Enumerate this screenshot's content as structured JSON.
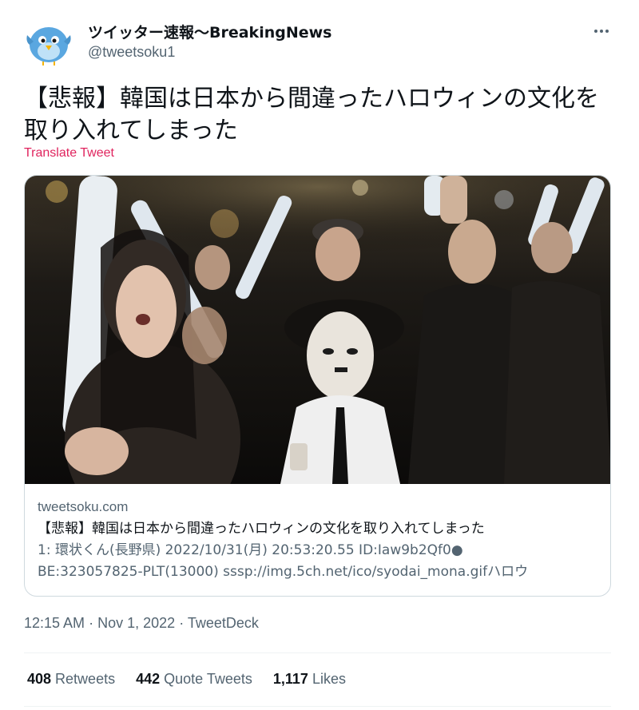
{
  "author": {
    "display_name": "ツイッター速報〜BreakingNews",
    "handle": "@tweetsoku1"
  },
  "tweet": {
    "text": "【悲報】韓国は日本から間違ったハロウィンの文化を取り入れてしまった",
    "translate_label": "Translate Tweet"
  },
  "card": {
    "domain": "tweetsoku.com",
    "title": "【悲報】韓国は日本から間違ったハロウィンの文化を取り入れてしまった",
    "description_line1": "1: 環状くん(長野県) 2022/10/31(月) 20:53:20.55 ID:Iaw9b2Qf0●",
    "description_line2": "BE:323057825-PLT(13000) sssp://img.5ch.net/ico/syodai_mona.gifハロウ"
  },
  "meta": {
    "time": "12:15 AM",
    "separator1": "·",
    "date": "Nov 1, 2022",
    "separator2": "·",
    "source": "TweetDeck"
  },
  "stats": {
    "retweets_count": "408",
    "retweets_label": "Retweets",
    "quotes_count": "442",
    "quotes_label": "Quote Tweets",
    "likes_count": "1,117",
    "likes_label": "Likes"
  },
  "colors": {
    "translate": "#e0245e",
    "secondary_text": "#536471",
    "primary_text": "#0f1419",
    "card_border": "#cfd9de",
    "avatar_bird": "#5aa7e0"
  },
  "icons": {
    "avatar": "blue-bird-avatar",
    "more": "more-options-icon"
  }
}
